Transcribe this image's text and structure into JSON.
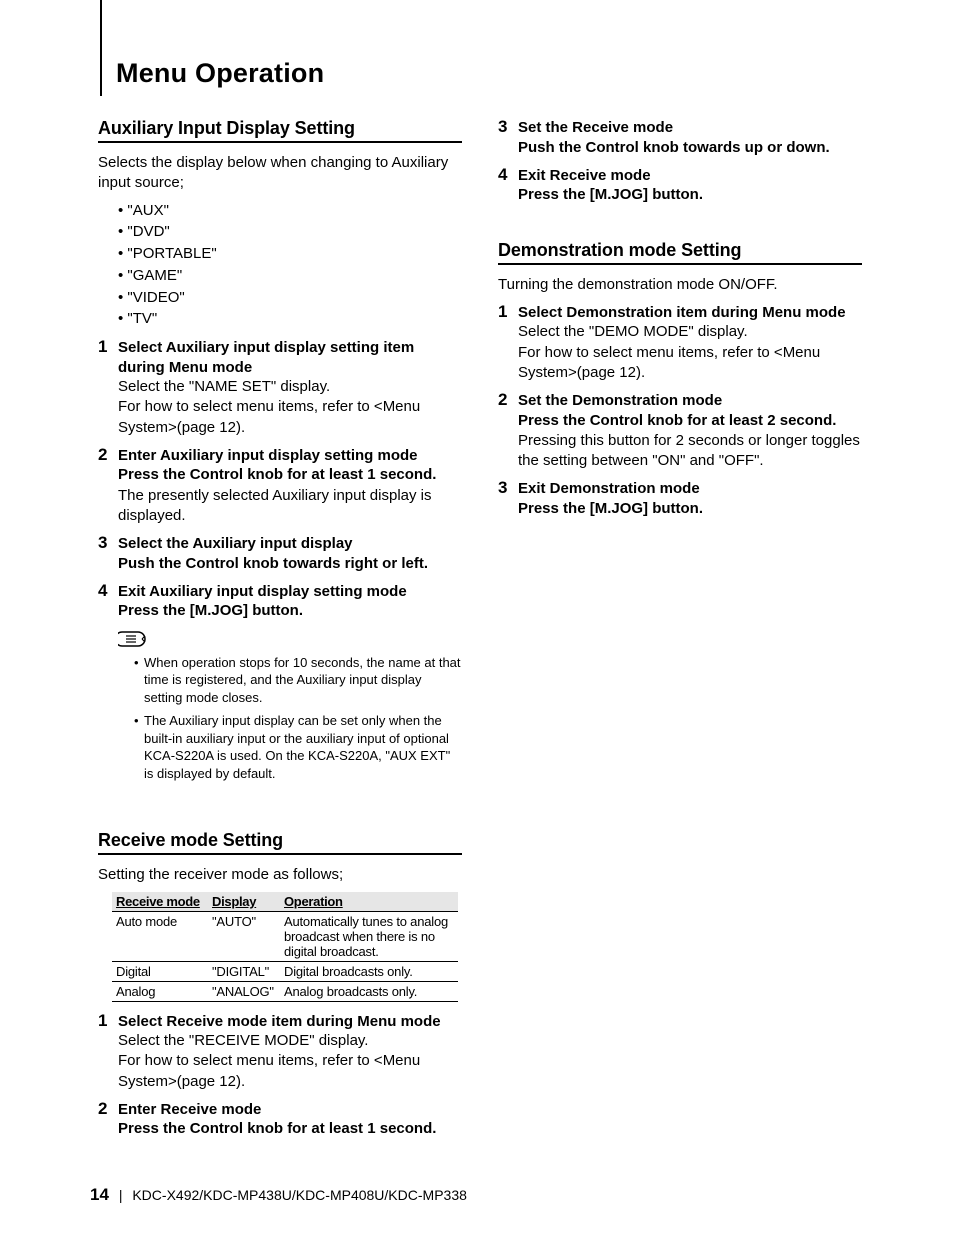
{
  "chapter": "Menu Operation",
  "footer": {
    "page": "14",
    "models": "KDC-X492/KDC-MP438U/KDC-MP408U/KDC-MP338"
  },
  "left": {
    "sec1": {
      "title": "Auxiliary Input Display Setting",
      "intro": "Selects the display below when changing to Auxiliary input source;",
      "options": [
        "\"AUX\"",
        "\"DVD\"",
        "\"PORTABLE\"",
        "\"GAME\"",
        "\"VIDEO\"",
        "\"TV\""
      ],
      "steps": [
        {
          "n": "1",
          "title": "Select Auxiliary input display setting item during Menu mode",
          "desc1": "Select the \"NAME SET\" display.",
          "desc2": "For how to select menu items, refer to <Menu System>(page 12)."
        },
        {
          "n": "2",
          "title": "Enter Auxiliary input display setting mode",
          "action": "Press the Control knob for at least 1 second.",
          "desc1": "The presently selected Auxiliary input display is displayed."
        },
        {
          "n": "3",
          "title": "Select the Auxiliary input display",
          "action": "Push the Control knob towards right or left."
        },
        {
          "n": "4",
          "title": "Exit Auxiliary input display setting mode",
          "action": "Press the [M.JOG] button."
        }
      ],
      "notes": [
        "When operation stops for 10 seconds, the name at that time is registered, and the Auxiliary input display setting mode closes.",
        "The Auxiliary input display can be set only when the built-in auxiliary input or the auxiliary input of optional KCA-S220A is used. On the KCA-S220A, \"AUX EXT\" is displayed by default."
      ]
    },
    "sec2": {
      "title": "Receive mode Setting",
      "intro": "Setting the receiver mode as follows;",
      "table": {
        "head": [
          "Receive mode",
          "Display",
          "Operation"
        ],
        "rows": [
          [
            "Auto mode",
            "\"AUTO\"",
            "Automatically tunes to analog broadcast when there is no digital broadcast."
          ],
          [
            "Digital",
            "\"DIGITAL\"",
            "Digital broadcasts only."
          ],
          [
            "Analog",
            "\"ANALOG\"",
            "Analog broadcasts only."
          ]
        ]
      },
      "steps": [
        {
          "n": "1",
          "title": "Select Receive mode item during Menu mode",
          "desc1": "Select the \"RECEIVE MODE\" display.",
          "desc2": "For how to select menu items, refer to <Menu System>(page 12)."
        },
        {
          "n": "2",
          "title": "Enter Receive mode",
          "action": "Press the Control knob for at least 1 second."
        }
      ]
    }
  },
  "right": {
    "cont": {
      "steps": [
        {
          "n": "3",
          "title": "Set the Receive mode",
          "action": "Push the Control knob towards up or down."
        },
        {
          "n": "4",
          "title": "Exit Receive mode",
          "action": "Press the [M.JOG] button."
        }
      ]
    },
    "sec3": {
      "title": "Demonstration mode Setting",
      "intro": "Turning the demonstration mode ON/OFF.",
      "steps": [
        {
          "n": "1",
          "title": "Select Demonstration item during Menu mode",
          "desc1": "Select the \"DEMO MODE\" display.",
          "desc2": "For how to select menu items, refer to <Menu System>(page 12)."
        },
        {
          "n": "2",
          "title": "Set the Demonstration mode",
          "action": "Press the Control knob for at least 2 second.",
          "desc1": "Pressing this button for 2 seconds or longer toggles the setting between \"ON\" and \"OFF\"."
        },
        {
          "n": "3",
          "title": "Exit Demonstration mode",
          "action": "Press the [M.JOG] button."
        }
      ]
    }
  }
}
